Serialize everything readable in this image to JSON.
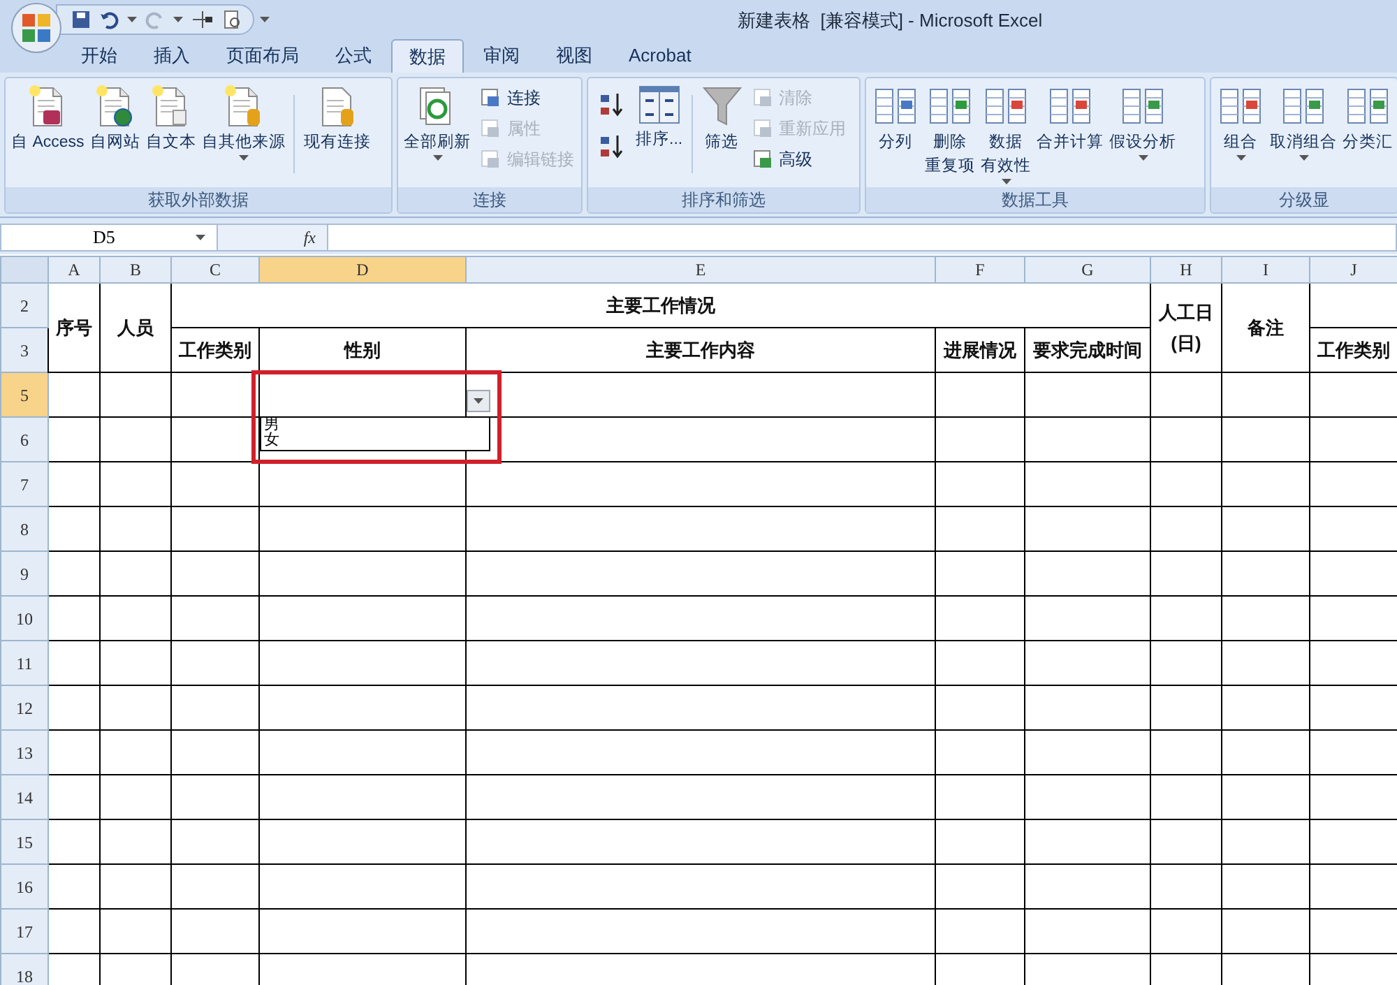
{
  "window": {
    "title": "新建表格  [兼容模式] - Microsoft Excel"
  },
  "tabs": [
    {
      "label": "开始",
      "selected": false
    },
    {
      "label": "插入",
      "selected": false
    },
    {
      "label": "页面布局",
      "selected": false
    },
    {
      "label": "公式",
      "selected": false
    },
    {
      "label": "数据",
      "selected": true
    },
    {
      "label": "审阅",
      "selected": false
    },
    {
      "label": "视图",
      "selected": false
    },
    {
      "label": "Acrobat",
      "selected": false
    }
  ],
  "ribbon": {
    "groups": [
      {
        "label": "获取外部数据",
        "items": [
          {
            "kind": "large",
            "label": "自 Access",
            "dropdown": false,
            "disabled": false
          },
          {
            "kind": "large",
            "label": "自网站",
            "dropdown": false,
            "disabled": false
          },
          {
            "kind": "large",
            "label": "自文本",
            "dropdown": false,
            "disabled": false
          },
          {
            "kind": "large",
            "label": "自其他来源",
            "dropdown": true,
            "disabled": false
          },
          {
            "kind": "separator"
          },
          {
            "kind": "large",
            "label": "现有连接",
            "dropdown": false,
            "disabled": false
          }
        ]
      },
      {
        "label": "连接",
        "items": [
          {
            "kind": "large",
            "label": "全部刷新",
            "dropdown": true,
            "disabled": false
          },
          {
            "kind": "stack",
            "items": [
              {
                "label": "连接",
                "disabled": false
              },
              {
                "label": "属性",
                "disabled": true
              },
              {
                "label": "编辑链接",
                "disabled": true
              }
            ]
          }
        ]
      },
      {
        "label": "排序和筛选",
        "items": [
          {
            "kind": "iconstack"
          },
          {
            "kind": "large",
            "label": "排序...",
            "dropdown": false,
            "disabled": false
          },
          {
            "kind": "separator"
          },
          {
            "kind": "large",
            "label": "筛选",
            "dropdown": false,
            "disabled": false
          },
          {
            "kind": "stack",
            "items": [
              {
                "label": "清除",
                "disabled": true
              },
              {
                "label": "重新应用",
                "disabled": true
              },
              {
                "label": "高级",
                "disabled": false
              }
            ]
          }
        ]
      },
      {
        "label": "数据工具",
        "items": [
          {
            "kind": "large",
            "label": "分列",
            "dropdown": false,
            "disabled": false
          },
          {
            "kind": "large",
            "label": "删除重复项",
            "dropdown": false,
            "disabled": false
          },
          {
            "kind": "large",
            "label": "数据有效性",
            "dropdown": true,
            "disabled": false
          },
          {
            "kind": "large",
            "label": "合并计算",
            "dropdown": false,
            "disabled": false
          },
          {
            "kind": "large",
            "label": "假设分析",
            "dropdown": true,
            "disabled": false
          }
        ]
      },
      {
        "label": "分级显",
        "items": [
          {
            "kind": "large",
            "label": "组合",
            "dropdown": true,
            "disabled": false
          },
          {
            "kind": "large",
            "label": "取消组合",
            "dropdown": true,
            "disabled": false
          },
          {
            "kind": "large",
            "label": "分类汇",
            "dropdown": false,
            "disabled": false
          }
        ]
      }
    ]
  },
  "formula_bar": {
    "name_box": "D5",
    "fx": "fx"
  },
  "sheet": {
    "columns": [
      {
        "label": "A",
        "selected": false
      },
      {
        "label": "B",
        "selected": false
      },
      {
        "label": "C",
        "selected": false
      },
      {
        "label": "D",
        "selected": true
      },
      {
        "label": "E",
        "selected": false
      },
      {
        "label": "F",
        "selected": false
      },
      {
        "label": "G",
        "selected": false
      },
      {
        "label": "H",
        "selected": false
      },
      {
        "label": "I",
        "selected": false
      },
      {
        "label": "J",
        "selected": false
      }
    ],
    "header_rows": [
      {
        "label": "2",
        "selected": false
      },
      {
        "label": "3",
        "selected": false
      }
    ],
    "rows": [
      {
        "label": "5",
        "selected": true
      },
      {
        "label": "6",
        "selected": false
      },
      {
        "label": "7",
        "selected": false
      },
      {
        "label": "8",
        "selected": false
      },
      {
        "label": "9",
        "selected": false
      },
      {
        "label": "10",
        "selected": false
      },
      {
        "label": "11",
        "selected": false
      },
      {
        "label": "12",
        "selected": false
      },
      {
        "label": "13",
        "selected": false
      },
      {
        "label": "14",
        "selected": false
      },
      {
        "label": "15",
        "selected": false
      },
      {
        "label": "16",
        "selected": false
      },
      {
        "label": "17",
        "selected": false
      },
      {
        "label": "18",
        "selected": false
      }
    ],
    "header": {
      "seq": "序号",
      "person": "人员",
      "main": "主要工作情况",
      "subs": [
        "工作类别",
        "性别",
        "主要工作内容",
        "进展情况",
        "要求完成时间"
      ],
      "days": "人工日\n(日)",
      "note": "备注",
      "extra": "工作类别"
    },
    "validation_list": {
      "options": [
        "男",
        "女"
      ]
    }
  }
}
